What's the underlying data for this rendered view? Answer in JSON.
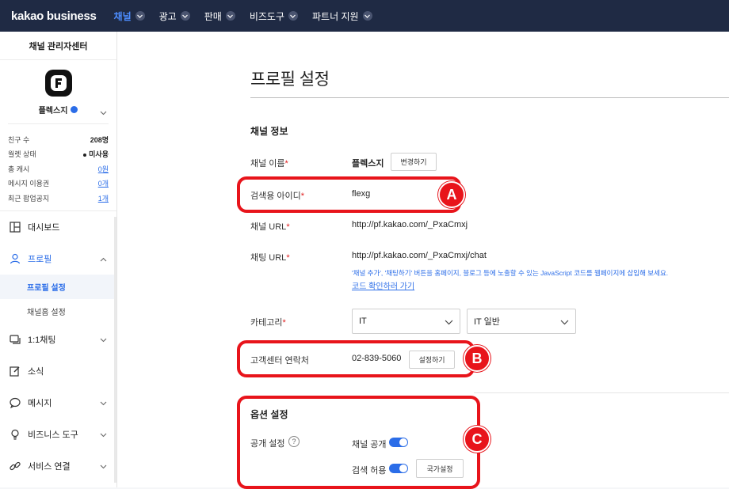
{
  "topbar": {
    "logo": "kakao business",
    "nav": [
      {
        "label": "채널",
        "active": true
      },
      {
        "label": "광고"
      },
      {
        "label": "판매"
      },
      {
        "label": "비즈도구"
      },
      {
        "label": "파트너 지원"
      }
    ]
  },
  "sidebar": {
    "title": "채널 관리자센터",
    "profile_name": "플렉스지",
    "stats": [
      {
        "label": "친구 수",
        "value": "208명"
      },
      {
        "label": "월렛 상태",
        "value": "미사용"
      },
      {
        "label": "총 캐시",
        "value": "0원"
      },
      {
        "label": "메시지 이용권",
        "value": "0개"
      },
      {
        "label": "최근 팝업공지",
        "value": "1개"
      }
    ],
    "menu": {
      "dashboard": "대시보드",
      "profile": "프로필",
      "profile_settings": "프로필 설정",
      "channel_home_settings": "채널홈 설정",
      "chat": "1:1채팅",
      "news": "소식",
      "message": "메시지",
      "business_tools": "비즈니스 도구",
      "service_link": "서비스 연결"
    }
  },
  "main": {
    "page_title": "프로필 설정",
    "channel_info_heading": "채널 정보",
    "required_mark": "*",
    "fields": {
      "channel_name": {
        "label": "채널 이름",
        "value": "플렉스지",
        "button": "변경하기"
      },
      "search_id": {
        "label": "검색용 아이디",
        "value": "flexg"
      },
      "channel_url": {
        "label": "채널 URL",
        "value": "http://pf.kakao.com/_PxaCmxj"
      },
      "chat_url": {
        "label": "채팅 URL",
        "value": "http://pf.kakao.com/_PxaCmxj/chat",
        "hint": "'채널 추가', '채팅하기' 버튼을 홈페이지, 블로그 등에 노출할 수 있는 JavaScript 코드를 웹페이지에 삽입해 보세요.",
        "hint_link": "코드 확인하러 가기"
      },
      "category": {
        "label": "카테고리",
        "primary": "IT",
        "secondary": "IT 일반"
      },
      "support_contact": {
        "label": "고객센터 연락처",
        "value": "02-839-5060",
        "button": "설정하기"
      }
    },
    "options_heading": "옵션 설정",
    "options": {
      "visibility_label": "공개 설정",
      "help_glyph": "?",
      "channel_public": {
        "label": "채널 공개",
        "on": true
      },
      "search_allowed": {
        "label": "검색 허용",
        "on": true
      },
      "country_button": "국가설정"
    }
  },
  "callouts": {
    "a": "A",
    "b": "B",
    "c": "C",
    "color": "#e8141b"
  }
}
